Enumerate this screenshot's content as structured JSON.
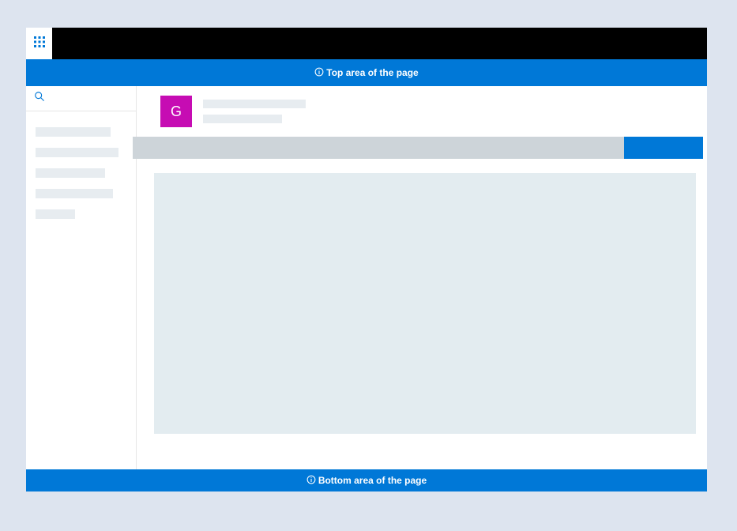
{
  "topCallout": "Top area of the page",
  "bottomCallout": "Bottom area of the page",
  "profile": {
    "avatarLetter": "G"
  },
  "colors": {
    "brand": "#0078d7",
    "avatar": "#c60cb3"
  }
}
